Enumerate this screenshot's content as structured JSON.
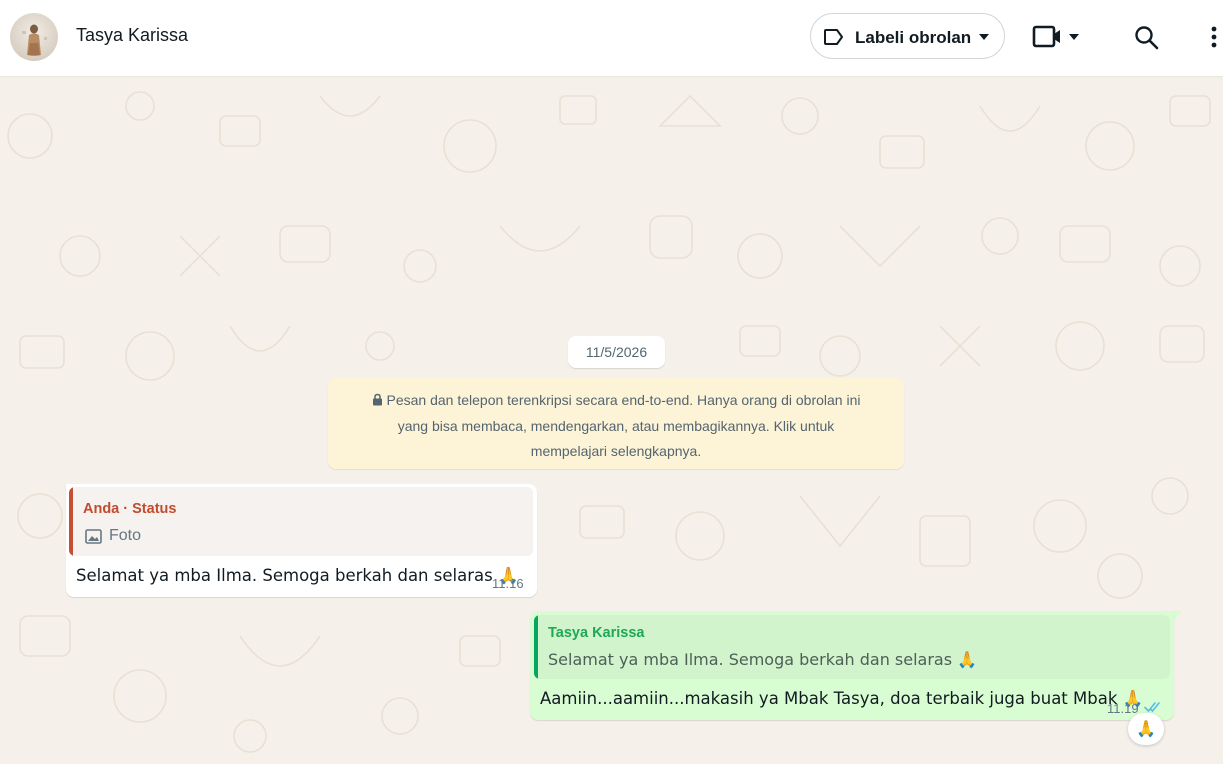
{
  "header": {
    "contact_name": "Tasya Karissa",
    "label_button": "Labeli obrolan"
  },
  "chat": {
    "date": "11/5/2026",
    "encryption_notice": "Pesan dan telepon terenkripsi secara end-to-end. Hanya orang di obrolan ini yang bisa membaca, mendengarkan, atau membagikannya. Klik untuk mempelajari selengkapnya.",
    "encryption_lines": [
      "Pesan dan telepon terenkripsi secara end-to-end. Hanya orang di obrolan ini",
      "yang bisa membaca, mendengarkan, atau membagikannya. Klik untuk",
      "mempelajari selengkapnya."
    ],
    "messages": [
      {
        "direction": "incoming",
        "quote_author": "Anda · Status",
        "quote_text": "Foto",
        "text": "Selamat ya mba Ilma. Semoga berkah dan selaras 🙏",
        "time": "11.16"
      },
      {
        "direction": "outgoing",
        "quote_author": "Tasya Karissa",
        "quote_text": "Selamat ya mba Ilma. Semoga berkah dan selaras 🙏",
        "text": "Aamiin...aamiin...makasih ya Mbak Tasya, doa terbaik juga buat Mbak 🙏",
        "time": "11.19",
        "status": "read",
        "reaction": "🙏"
      }
    ]
  },
  "colors": {
    "chat_bg": "#f5f1ea",
    "outgoing_bubble": "#d9fdd3",
    "incoming_bubble": "#ffffff",
    "encryption_bg": "#fdf3d7",
    "quote_status_accent": "#c34f34",
    "quote_contact_accent": "#06a660",
    "read_ticks": "#53bdeb"
  },
  "icons": {
    "label": "tag-outline-icon",
    "video": "video-camera-icon",
    "search": "search-icon",
    "menu": "kebab-menu-icon",
    "lock": "lock-icon",
    "image": "image-icon",
    "read": "double-check-icon"
  }
}
